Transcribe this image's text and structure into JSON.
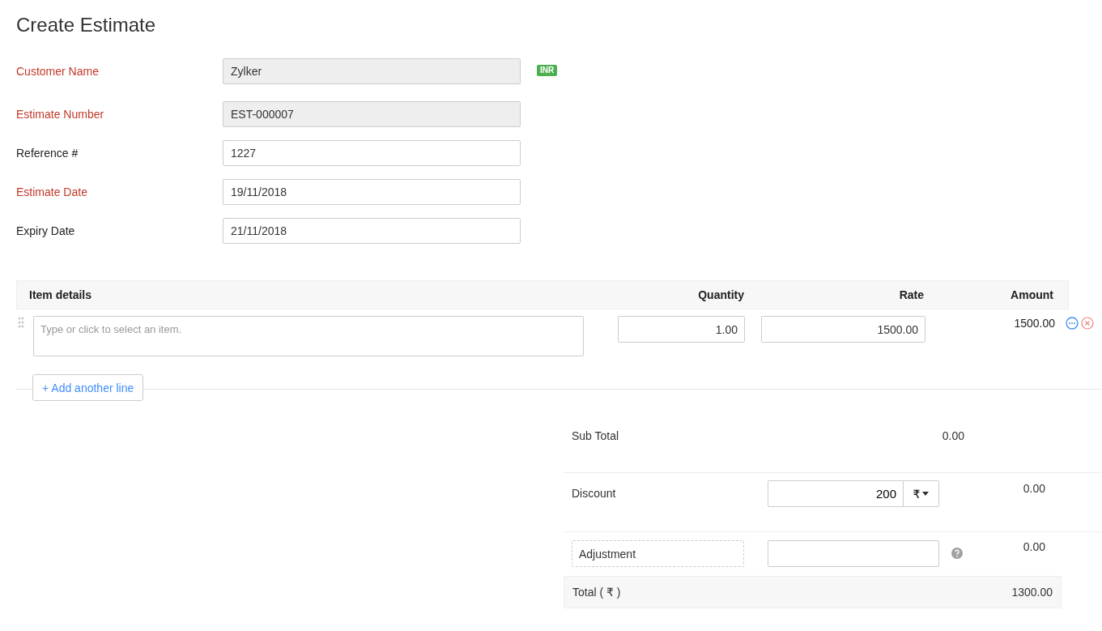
{
  "page": {
    "title": "Create Estimate"
  },
  "form_fields": [
    {
      "label": "Customer Name",
      "value": "Zylker",
      "required": true,
      "disabled": true,
      "badge": "INR"
    },
    {
      "label": "Estimate Number",
      "value": "EST-000007",
      "required": true,
      "disabled": true
    },
    {
      "label": "Reference #",
      "value": "1227",
      "required": false,
      "disabled": false
    },
    {
      "label": "Estimate Date",
      "value": "19/11/2018",
      "required": true,
      "disabled": false
    },
    {
      "label": "Expiry Date",
      "value": "21/11/2018",
      "required": false,
      "disabled": false
    }
  ],
  "items_table": {
    "columns": [
      "Item details",
      "Quantity",
      "Rate",
      "Amount"
    ],
    "rows": [
      {
        "item": {
          "placeholder": "Type or click to select an item."
        },
        "quantity": "1.00",
        "rate": "1500.00",
        "amount": "1500.00"
      }
    ],
    "add_line": "+ Add another line"
  },
  "totals": {
    "sub_total": {
      "label": "Sub Total",
      "value": "0.00"
    },
    "discount": {
      "label": "Discount",
      "input": "200",
      "unit": "₹",
      "value": "0.00"
    },
    "adjustment": {
      "label": "Adjustment",
      "value": "0.00"
    },
    "total": {
      "label": "Total ( ₹ )",
      "value": "1300.00"
    }
  }
}
